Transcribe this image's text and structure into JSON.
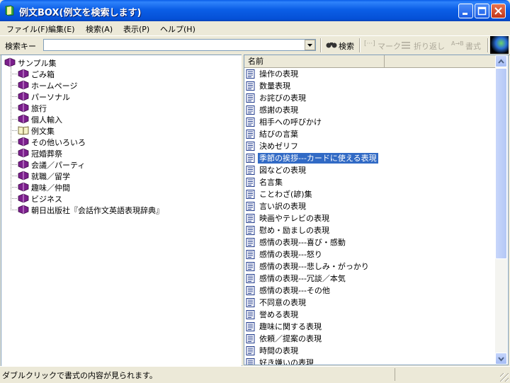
{
  "window": {
    "title": "例文BOX(例文を検索します)",
    "icons": {
      "app": "book-icon",
      "minimize": "minimize-icon",
      "maximize": "maximize-icon",
      "close": "close-icon"
    }
  },
  "menu": [
    "ファイル(F)",
    "編集(E)",
    "検索(A)",
    "表示(P)",
    "ヘルプ(H)"
  ],
  "toolbar": {
    "search_label": "検索キー",
    "search_value": "",
    "search_button": "検索",
    "mark_button": "マーク",
    "wrap_button": "折り返し",
    "format_button": "書式"
  },
  "tree": {
    "root": "サンプル集",
    "children": [
      "ごみ箱",
      "ホームページ",
      "パーソナル",
      "旅行",
      "個人輸入",
      "例文集",
      "その他いろいろ",
      "冠婚葬祭",
      "会議／パーティ",
      "就職／留学",
      "趣味／仲間",
      "ビジネス",
      "朝日出版社『会話作文英語表現辞典』"
    ]
  },
  "list": {
    "column_name": "名前",
    "selected_index": 7,
    "items": [
      "操作の表現",
      "数量表現",
      "お詫びの表現",
      "感謝の表現",
      "相手への呼びかけ",
      "結びの言葉",
      "決めゼリフ",
      "季節の挨拶---カードに使える表現",
      "図などの表現",
      "名言集",
      "ことわざ(諺)集",
      "言い訳の表現",
      "映画やテレビの表現",
      "慰め・励ましの表現",
      "感情の表現---喜び・感動",
      "感情の表現---怒り",
      "感情の表現---悲しみ・がっかり",
      "感情の表現---冗談／本気",
      "感情の表現---その他",
      "不同意の表現",
      "誉める表現",
      "趣味に関する表現",
      "依頼／提案の表現",
      "時間の表現",
      "好き嫌いの表現"
    ]
  },
  "status": {
    "text": "ダブルクリックで書式の内容が見られます。"
  },
  "colors": {
    "titlebar": "#0a5de8",
    "selection": "#316ac5",
    "book": "#7b1f8c"
  }
}
